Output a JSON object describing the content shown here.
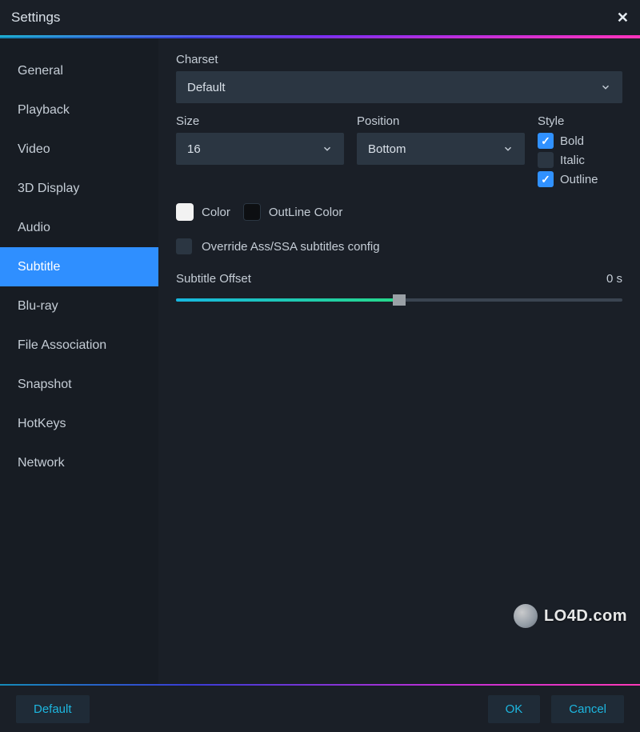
{
  "window": {
    "title": "Settings"
  },
  "sidebar": {
    "items": [
      {
        "label": "General"
      },
      {
        "label": "Playback"
      },
      {
        "label": "Video"
      },
      {
        "label": "3D Display"
      },
      {
        "label": "Audio"
      },
      {
        "label": "Subtitle"
      },
      {
        "label": "Blu-ray"
      },
      {
        "label": "File Association"
      },
      {
        "label": "Snapshot"
      },
      {
        "label": "HotKeys"
      },
      {
        "label": "Network"
      }
    ],
    "active_index": 5
  },
  "subtitle_panel": {
    "charset_label": "Charset",
    "charset_value": "Default",
    "size_label": "Size",
    "size_value": "16",
    "position_label": "Position",
    "position_value": "Bottom",
    "style_label": "Style",
    "style_options": {
      "bold": {
        "label": "Bold",
        "checked": true
      },
      "italic": {
        "label": "Italic",
        "checked": false
      },
      "outline": {
        "label": "Outline",
        "checked": true
      }
    },
    "color_label": "Color",
    "color_value": "#F2F2F2",
    "outline_color_label": "OutLine Color",
    "outline_color_value": "#0D0F12",
    "override_label": "Override Ass/SSA subtitles config",
    "override_checked": false,
    "offset_label": "Subtitle Offset",
    "offset_value_text": "0 s",
    "offset_percent": 50
  },
  "footer": {
    "default_label": "Default",
    "ok_label": "OK",
    "cancel_label": "Cancel"
  },
  "watermark": {
    "text": "LO4D.com"
  }
}
